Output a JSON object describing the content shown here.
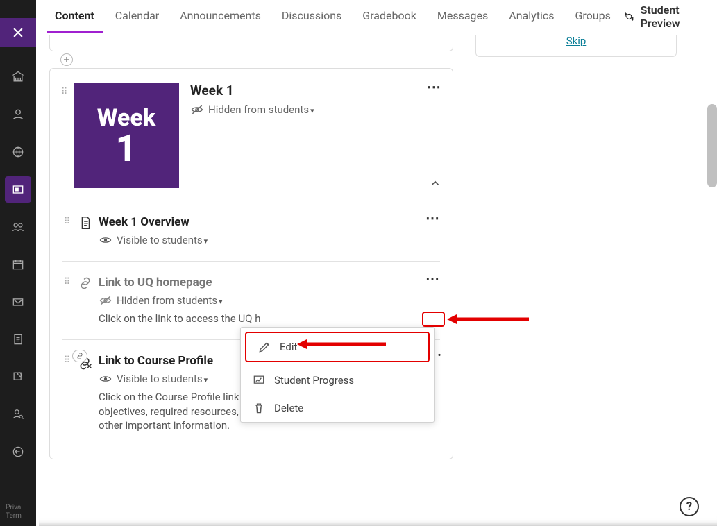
{
  "tabs": {
    "content": "Content",
    "calendar": "Calendar",
    "announcements": "Announcements",
    "discussions": "Discussions",
    "gradebook": "Gradebook",
    "messages": "Messages",
    "analytics": "Analytics",
    "groups": "Groups",
    "student_preview": "Student Preview"
  },
  "right_panel": {
    "skip": "Skip"
  },
  "module": {
    "thumb_line1": "Week",
    "thumb_line2": "1",
    "title": "Week 1",
    "visibility": "Hidden from students"
  },
  "items": [
    {
      "title": "Week 1 Overview",
      "visibility": "Visible to students",
      "description": ""
    },
    {
      "title": "Link to UQ homepage",
      "visibility": "Hidden from students",
      "description": "Click on the link to access the UQ h"
    },
    {
      "title": "Link to Course Profile",
      "visibility": "Visible to students",
      "description": "Click on the Course Profile link to view the course aims and learning objectives, required resources, assessment criteria and due dates, and other important information."
    }
  ],
  "menu": {
    "edit": "Edit",
    "student_progress": "Student Progress",
    "delete": "Delete"
  },
  "rail_footer": {
    "l1": "Priva",
    "l2": "Term"
  },
  "help": "?"
}
